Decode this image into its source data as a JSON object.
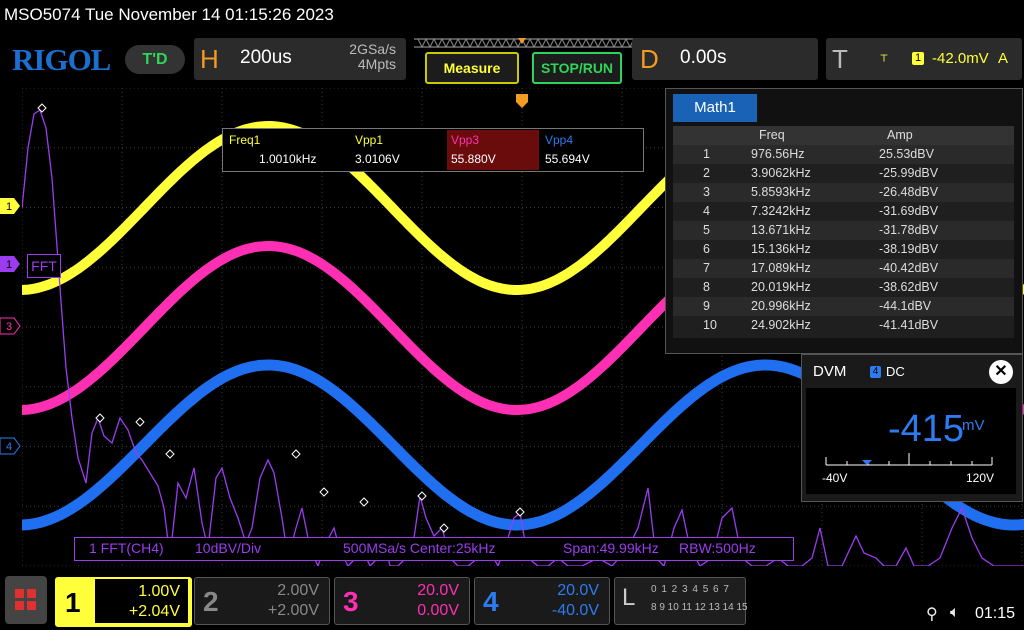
{
  "header": {
    "title_line": "MSO5074  Tue November 14 01:15:26 2023",
    "logo": "RIGOL",
    "run_mode": "T'D"
  },
  "horizontal": {
    "letter": "H",
    "timebase": "200us",
    "sample_rate": "2GSa/s",
    "memory_depth": "4Mpts"
  },
  "buttons": {
    "measure": "Measure",
    "stop_run": "STOP/RUN"
  },
  "delay": {
    "letter": "D",
    "value": "0.00s"
  },
  "trigger": {
    "letter": "T",
    "slope_icon": "rising-edge-icon",
    "source": "1",
    "level": "-42.0mV",
    "mode": "A"
  },
  "measurements": {
    "headers": [
      "Freq1",
      "Vpp1",
      "Vpp3",
      "Vpp4"
    ],
    "values": [
      "1.0010kHz",
      "3.0106V",
      "55.880V",
      "55.694V"
    ],
    "colors": [
      "#ffff3a",
      "#ffff3a",
      "#ff2fb4",
      "#2d7bf0"
    ]
  },
  "math_panel": {
    "tab": "Math1",
    "columns": [
      "",
      "Freq",
      "Amp"
    ],
    "rows": [
      [
        "1",
        "976.56Hz",
        "25.53dBV"
      ],
      [
        "2",
        "3.9062kHz",
        "-25.99dBV"
      ],
      [
        "3",
        "5.8593kHz",
        "-26.48dBV"
      ],
      [
        "4",
        "7.3242kHz",
        "-31.69dBV"
      ],
      [
        "5",
        "13.671kHz",
        "-31.78dBV"
      ],
      [
        "6",
        "15.136kHz",
        "-38.19dBV"
      ],
      [
        "7",
        "17.089kHz",
        "-40.42dBV"
      ],
      [
        "8",
        "20.019kHz",
        "-38.62dBV"
      ],
      [
        "9",
        "20.996kHz",
        "-44.1dBV"
      ],
      [
        "10",
        "24.902kHz",
        "-41.41dBV"
      ]
    ]
  },
  "dvm": {
    "title": "DVM",
    "channel": "4",
    "mode": "DC",
    "value": "-415",
    "unit": "mV",
    "min": "-40V",
    "max": "120V",
    "close_icon": "close-icon"
  },
  "fft_info": {
    "source": "1  FFT(CH4)",
    "scale": "10dBV/Div",
    "rate_center": "500MSa/s Center:25kHz",
    "span": "Span:49.99kHz",
    "rbw": "RBW:500Hz"
  },
  "fft_label": "FFT",
  "markers": {
    "ch1": "1",
    "math": "1",
    "ch3": "3",
    "ch4": "4"
  },
  "channels": [
    {
      "num": "1",
      "scale": "1.00V",
      "offset": "+2.04V",
      "color": "#ffff3a",
      "active": true
    },
    {
      "num": "2",
      "scale": "2.00V",
      "offset": "+2.00V",
      "color": "#888888",
      "active": false
    },
    {
      "num": "3",
      "scale": "20.0V",
      "offset": "0.00V",
      "color": "#ff2fb4",
      "active": false
    },
    {
      "num": "4",
      "scale": "20.0V",
      "offset": "-40.0V",
      "color": "#2d7bf0",
      "active": false
    }
  ],
  "logic": {
    "letter": "L",
    "bits_row1": "0 1 2 3  4 5 6 7",
    "bits_row2": "8 9 10 11 12 13 14 15"
  },
  "status": {
    "usb_icon": "usb-icon",
    "speaker_icon": "mute-speaker-icon",
    "time": "01:15"
  }
}
